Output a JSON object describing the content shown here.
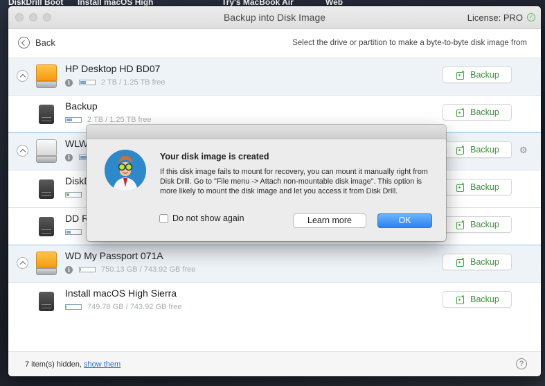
{
  "desktop": {
    "labels": [
      "DiskDrill Boot",
      "Try's MacBook Air",
      "Install macOS High",
      "Web"
    ]
  },
  "window": {
    "title": "Backup into Disk Image",
    "license": "License: PRO"
  },
  "nav": {
    "back_label": "Back",
    "hint": "Select the drive or partition to make a byte-to-byte disk image from"
  },
  "rows": [
    {
      "name": "HP Desktop HD BD07",
      "capacity": "2 TB / 1.25 TB free",
      "fill": 0.38,
      "kind": "disk",
      "backup_label": "Backup"
    },
    {
      "name": "Backup",
      "capacity": "2 TB / 1.25 TB free",
      "fill": 0.38,
      "kind": "partition",
      "backup_label": "Backup"
    },
    {
      "name": "WLW",
      "capacity": "",
      "fill": 0.5,
      "kind": "disk",
      "backup_label": "Backup"
    },
    {
      "name": "DiskD",
      "capacity": "",
      "fill": 0.2,
      "kind": "partition",
      "backup_label": "Backup"
    },
    {
      "name": "DD R",
      "capacity": "",
      "fill": 0.3,
      "kind": "partition",
      "backup_label": "Backup"
    },
    {
      "name": "WD My Passport 071A",
      "capacity": "750.13 GB / 743.92 GB free",
      "fill": 0.01,
      "kind": "disk",
      "backup_label": "Backup"
    },
    {
      "name": "Install macOS High Sierra",
      "capacity": "749.78 GB / 743.92 GB free",
      "fill": 0.01,
      "kind": "partition",
      "backup_label": "Backup"
    }
  ],
  "footer": {
    "hidden_text": "7 item(s) hidden,",
    "show_link": "show them",
    "help_label": "?"
  },
  "dialog": {
    "title": "Your disk image is created",
    "body": "If this disk image fails to mount for recovery, you can mount it manually right from Disk Drill. Go to \"File menu -> Attach non-mountable disk image\". This option is more likely to mount the disk image and let you access it from Disk Drill.",
    "checkbox_label": "Do not show again",
    "learn_more_label": "Learn more",
    "ok_label": "OK"
  },
  "colors": {
    "accent_blue": "#2a83f0",
    "backup_green": "#4aa34a",
    "disk_orange": "#f49b0f"
  }
}
